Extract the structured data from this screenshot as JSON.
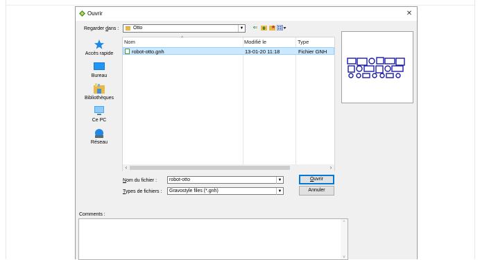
{
  "dialog": {
    "title": "Ouvrir",
    "close_glyph": "✕"
  },
  "lookin": {
    "label_pre": "Regarder ",
    "label_ul": "d",
    "label_post": "ans :",
    "value": "Otto"
  },
  "toolbar": {
    "back_icon": "back-arrow-icon",
    "up_icon": "up-folder-icon",
    "new_folder_icon": "new-folder-icon",
    "view_icon": "view-menu-icon"
  },
  "places": [
    {
      "label": "Accès rapide",
      "icon": "star-icon"
    },
    {
      "label": "Bureau",
      "icon": "desktop-icon"
    },
    {
      "label": "Bibliothèques",
      "icon": "library-icon"
    },
    {
      "label": "Ce PC",
      "icon": "pc-icon"
    },
    {
      "label": "Réseau",
      "icon": "network-icon"
    }
  ],
  "filelist": {
    "columns": [
      "Nom",
      "Modifié le",
      "Type"
    ],
    "rows": [
      {
        "name": "robot-otto.gnh",
        "modified": "13-01-20 11:18",
        "type": "Fichier GNH",
        "selected": true
      }
    ]
  },
  "filename": {
    "label_ul": "N",
    "label_post": "om du fichier :",
    "value": "robot-otto"
  },
  "filetype": {
    "label_ul": "T",
    "label_post": "ypes de fichiers :",
    "value": "Gravostyle files (*.gnh)"
  },
  "buttons": {
    "open_ul": "O",
    "open_post": "uvrir",
    "cancel": "Annuler"
  },
  "comments": {
    "label": "Comments :",
    "value": ""
  },
  "colors": {
    "selection": "#cce8ff",
    "accent": "#0078d7"
  }
}
